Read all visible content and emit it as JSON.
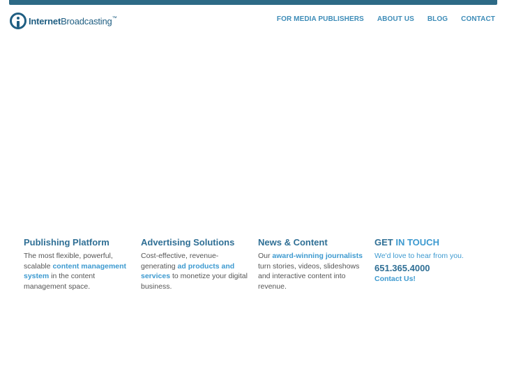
{
  "header": {
    "logo": {
      "bold": "Internet",
      "thin": "Broadcasting",
      "tm": "™"
    },
    "nav": [
      "FOR MEDIA PUBLISHERS",
      "ABOUT US",
      "BLOG",
      "CONTACT"
    ]
  },
  "columns": {
    "publishing": {
      "title": "Publishing Platform",
      "text_before": "The most flexible, powerful, scalable ",
      "link": "content management system",
      "text_after": " in the content management space."
    },
    "advertising": {
      "title": "Advertising Solutions",
      "text_before": "Cost-effective, revenue-generating ",
      "link": "ad products and services",
      "text_after": " to monetize your digital business."
    },
    "news": {
      "title": "News & Content",
      "text_before": "Our ",
      "link": "award-winning journalists",
      "text_after": " turn stories, videos, slideshows and interactive content into revenue."
    },
    "touch": {
      "title_plain": "GET",
      "title_accent": "IN TOUCH",
      "text": "We'd love to hear from you.",
      "phone": "651.365.4000",
      "link": "Contact Us!"
    }
  },
  "colors": {
    "topbar": "#2d6a86",
    "primary": "#2f6f95",
    "accent": "#3d9ad0"
  }
}
